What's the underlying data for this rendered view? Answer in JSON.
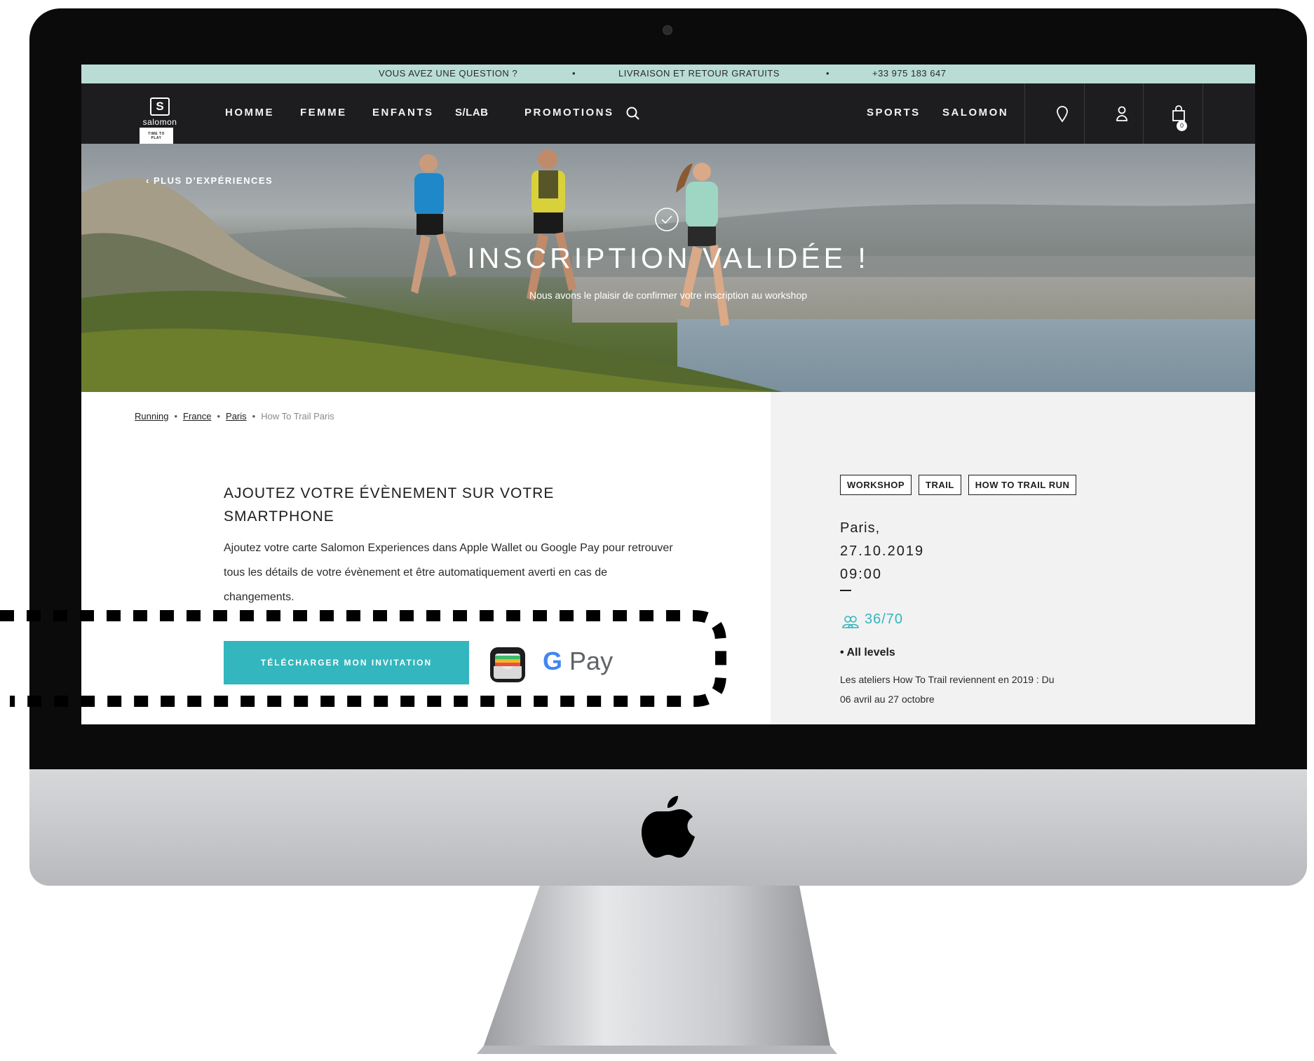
{
  "announcement_bar": {
    "question": "VOUS AVEZ UNE QUESTION ?",
    "delivery": "LIVRAISON ET RETOUR GRATUITS",
    "phone": "+33 975 183 647"
  },
  "nav": {
    "logo_brand": "salomon",
    "logo_tagline": "TIME TO PLAY",
    "items": [
      "HOMME",
      "FEMME",
      "ENFANTS",
      "S/LAB",
      "PROMOTIONS"
    ],
    "right_items": [
      "SPORTS",
      "SALOMON"
    ],
    "cart_count": "0",
    "icons": [
      "search-icon",
      "location-pin-icon",
      "user-icon",
      "cart-icon"
    ]
  },
  "hero": {
    "back_link": "PLUS D'EXPÉRIENCES",
    "title": "INSCRIPTION VALIDÉE !",
    "subtitle": "Nous avons le plaisir de confirmer votre inscription au workshop"
  },
  "breadcrumb": {
    "items": [
      "Running",
      "France",
      "Paris"
    ],
    "current": "How To Trail Paris"
  },
  "wallet_section": {
    "title": "AJOUTEZ VOTRE ÉVÈNEMENT SUR VOTRE SMARTPHONE",
    "text": "Ajoutez votre carte Salomon Experiences dans Apple Wallet ou Google Pay pour retrouver tous les détails de votre évènement et être automatiquement averti en cas de changements.",
    "download_label": "TÉLÉCHARGER MON INVITATION",
    "gpay_g": "G",
    "gpay_label": "Pay"
  },
  "event": {
    "tags": [
      "WORKSHOP",
      "TRAIL",
      "HOW TO TRAIL RUN"
    ],
    "city": "Paris,",
    "date": "27.10.2019",
    "time": "09:00",
    "capacity": "36/70",
    "level": "All levels",
    "description": "Les ateliers How To Trail reviennent en 2019 : Du 06 avril au 27 octobre"
  },
  "colors": {
    "accent": "#33b6bd",
    "announcement_bg": "#b9ddd5",
    "nav_bg": "#1d1d1f",
    "sidebar_bg": "#f2f2f2"
  }
}
